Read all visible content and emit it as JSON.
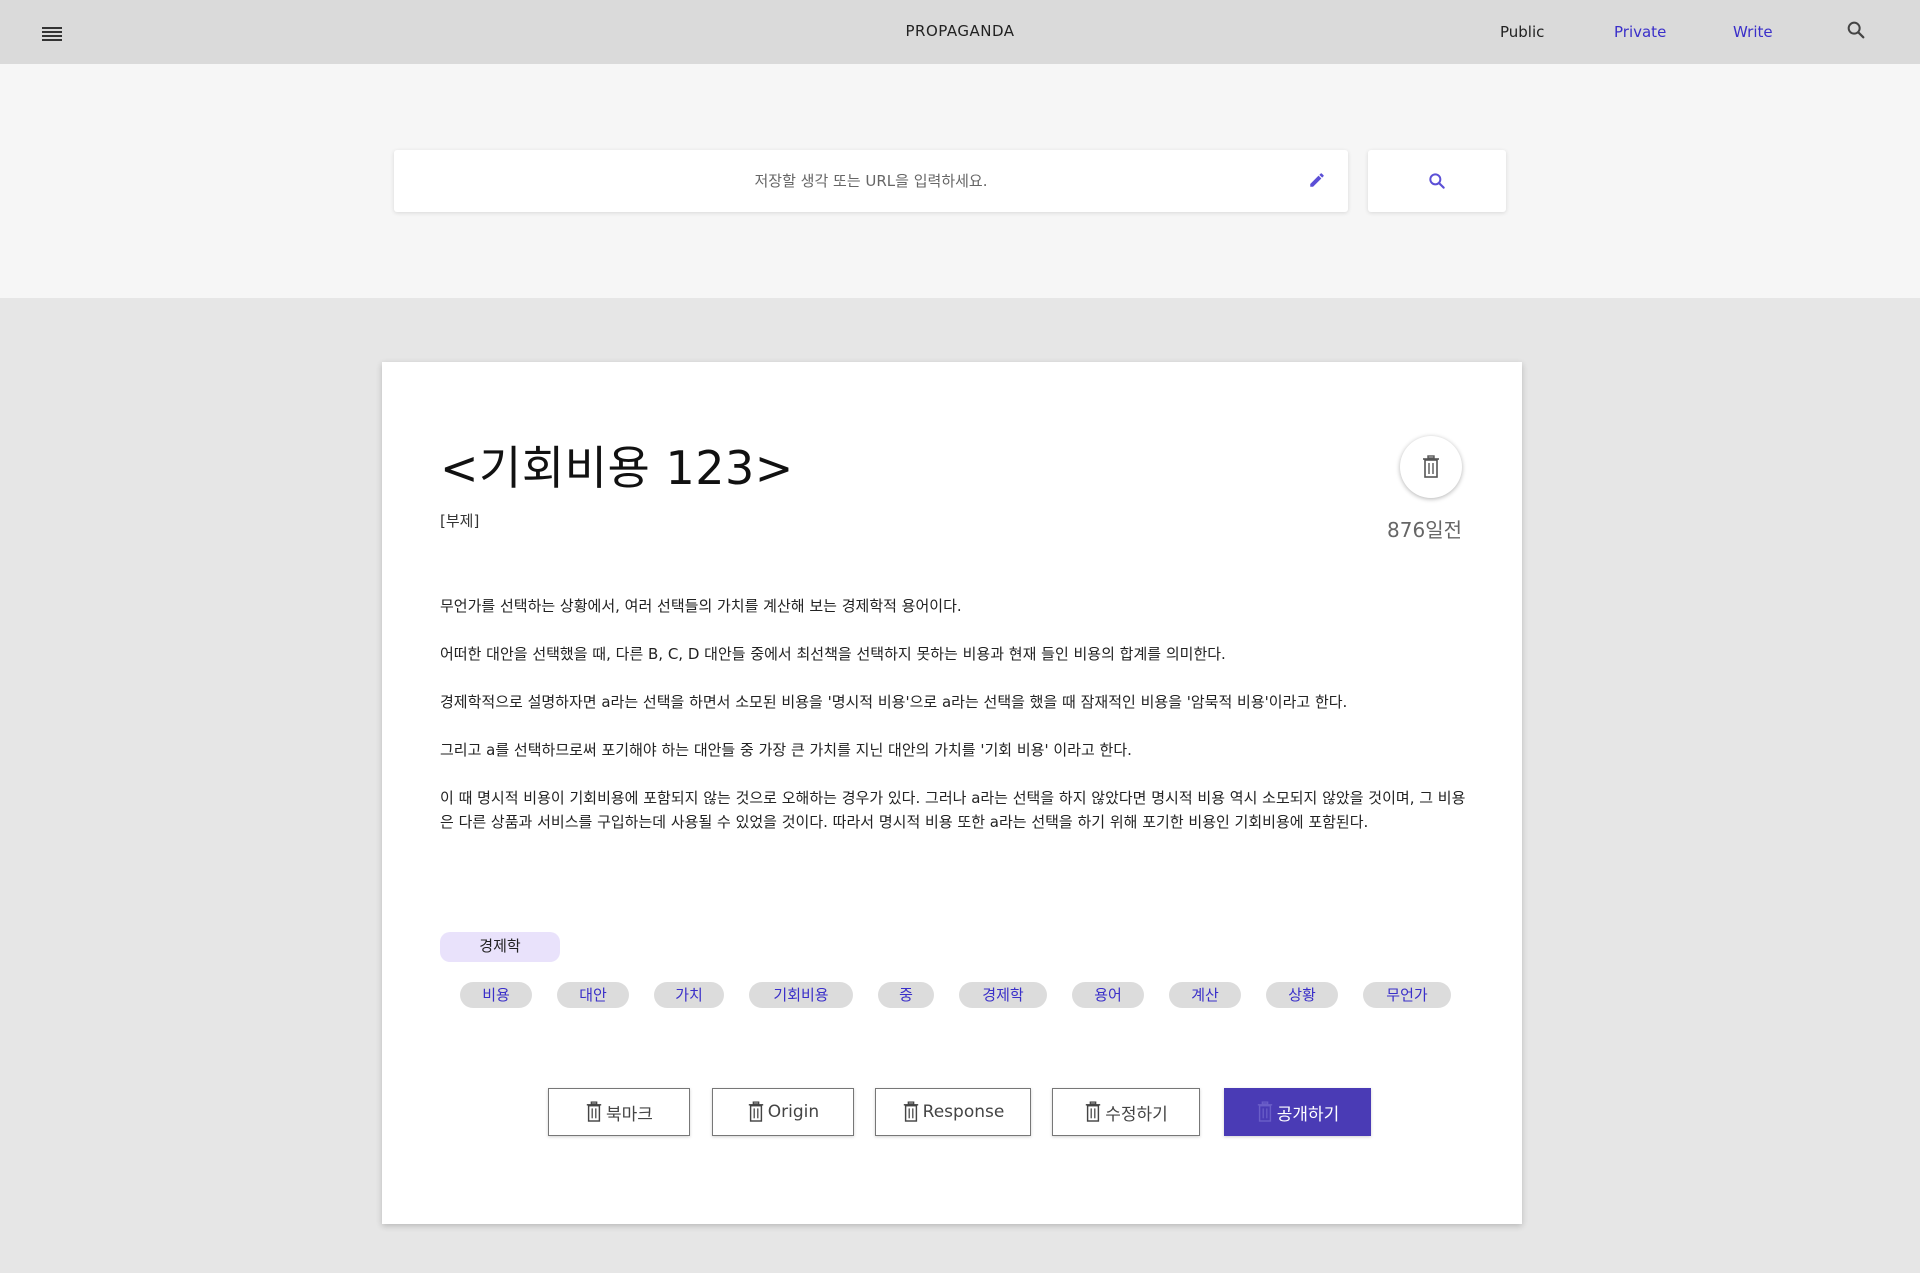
{
  "header": {
    "brand": "PROPAGANDA",
    "nav": {
      "public": "Public",
      "private": "Private",
      "write": "Write"
    }
  },
  "search": {
    "placeholder": "저장할 생각 또는 URL을 입력하세요."
  },
  "post": {
    "title": "<기회비용 123>",
    "subtitle": "[부제]",
    "age": "876일전",
    "paragraphs": [
      "무언가를 선택하는 상황에서, 여러 선택들의 가치를 계산해 보는 경제학적 용어이다.",
      "어떠한 대안을 선택했을 때, 다른 B, C, D 대안들 중에서 최선책을 선택하지 못하는 비용과 현재 들인 비용의 합계를 의미한다.",
      "경제학적으로 설명하자면 a라는 선택을 하면서 소모된 비용을 '명시적 비용'으로 a라는 선택을 했을 때 잠재적인 비용을 '암묵적 비용'이라고 한다.",
      "그리고 a를 선택하므로써 포기해야 하는 대안들 중 가장 큰 가치를 지닌 대안의 가치를 '기회 비용' 이라고 한다.",
      "이 때 명시적 비용이 기회비용에 포함되지 않는 것으로 오해하는 경우가 있다. 그러나 a라는 선택을 하지 않았다면 명시적 비용 역시 소모되지 않았을 것이며, 그 비용은 다른 상품과 서비스를 구입하는데 사용될 수 있었을 것이다. 따라서 명시적 비용 또한 a라는 선택을 하기 위해 포기한 비용인 기회비용에 포함된다."
    ],
    "category": "경제학",
    "tags": [
      "비용",
      "대안",
      "가치",
      "기회비용",
      "중",
      "경제학",
      "용어",
      "계산",
      "상황",
      "무언가"
    ]
  },
  "actions": {
    "bookmark": "북마크",
    "origin": "Origin",
    "response": "Response",
    "edit": "수정하기",
    "publish": "공개하기"
  },
  "colors": {
    "accent": "#3a2fc9",
    "primary_button": "#4a3bb5",
    "category_chip": "#e9e2fb",
    "tag_chip": "#dcdcdc",
    "topbar": "#dadada"
  }
}
